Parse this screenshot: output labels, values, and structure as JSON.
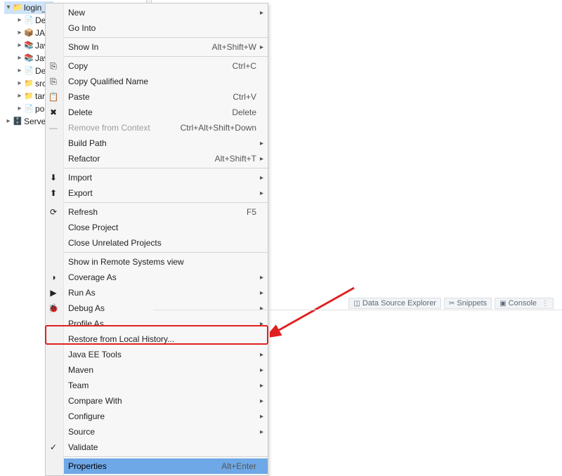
{
  "tree": {
    "root_label": "login_t",
    "children": [
      {
        "label": "Dep"
      },
      {
        "label": "JAX-"
      },
      {
        "label": "Java"
      },
      {
        "label": "Java"
      },
      {
        "label": "Dep"
      },
      {
        "label": "src"
      },
      {
        "label": "targ"
      },
      {
        "label": "pom"
      }
    ],
    "sibling": "Servers"
  },
  "menu": {
    "items": [
      {
        "label": "New",
        "submenu": true
      },
      {
        "label": "Go Into"
      },
      {
        "sep": true
      },
      {
        "label": "Show In",
        "accel": "Alt+Shift+W",
        "submenu": true
      },
      {
        "sep": true
      },
      {
        "label": "Copy",
        "accel": "Ctrl+C",
        "icon": "copy"
      },
      {
        "label": "Copy Qualified Name",
        "icon": "copy"
      },
      {
        "label": "Paste",
        "accel": "Ctrl+V",
        "icon": "paste"
      },
      {
        "label": "Delete",
        "accel": "Delete",
        "icon": "delete"
      },
      {
        "label": "Remove from Context",
        "accel": "Ctrl+Alt+Shift+Down",
        "disabled": true,
        "icon": "minus"
      },
      {
        "label": "Build Path",
        "submenu": true
      },
      {
        "label": "Refactor",
        "accel": "Alt+Shift+T",
        "submenu": true
      },
      {
        "sep": true
      },
      {
        "label": "Import",
        "submenu": true,
        "icon": "import"
      },
      {
        "label": "Export",
        "submenu": true,
        "icon": "export"
      },
      {
        "sep": true
      },
      {
        "label": "Refresh",
        "accel": "F5",
        "icon": "refresh"
      },
      {
        "label": "Close Project"
      },
      {
        "label": "Close Unrelated Projects"
      },
      {
        "sep": true
      },
      {
        "label": "Show in Remote Systems view"
      },
      {
        "label": "Coverage As",
        "submenu": true,
        "icon": "coverage"
      },
      {
        "label": "Run As",
        "submenu": true,
        "icon": "run"
      },
      {
        "label": "Debug As",
        "submenu": true,
        "icon": "debug"
      },
      {
        "label": "Profile As",
        "submenu": true
      },
      {
        "label": "Restore from Local History..."
      },
      {
        "label": "Java EE Tools",
        "submenu": true
      },
      {
        "label": "Maven",
        "submenu": true
      },
      {
        "label": "Team",
        "submenu": true
      },
      {
        "label": "Compare With",
        "submenu": true
      },
      {
        "label": "Configure",
        "submenu": true
      },
      {
        "label": "Source",
        "submenu": true
      },
      {
        "label": "Validate",
        "icon": "validate"
      },
      {
        "sep": true
      },
      {
        "label": "Properties",
        "accel": "Alt+Enter",
        "selected": true
      }
    ]
  },
  "bottom_tabs": {
    "items": [
      {
        "label": "Data Source Explorer",
        "icon": "db"
      },
      {
        "label": "Snippets",
        "icon": "snip"
      },
      {
        "label": "Console",
        "icon": "console",
        "active": true
      }
    ]
  }
}
